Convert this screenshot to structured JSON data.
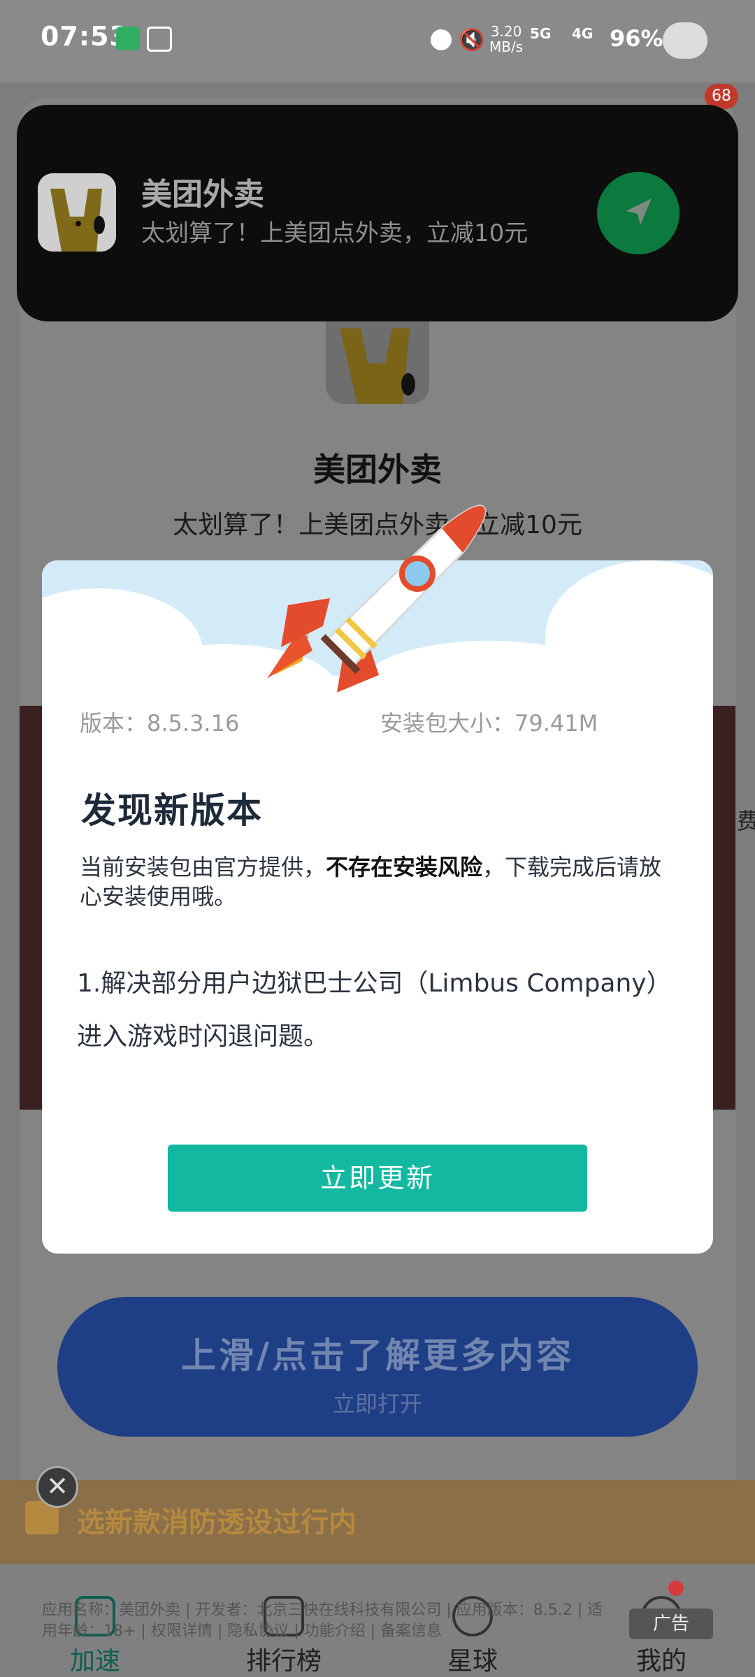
{
  "status_bar": {
    "time": "07:53",
    "net_speed": "3.20",
    "net_unit": "MB/s",
    "sim1": "5G",
    "sim2": "4G",
    "battery": "96%"
  },
  "notification": {
    "app_name": "美团外卖",
    "message": "太划算了！上美团点外卖，立减10元",
    "badge_count": "68"
  },
  "background_page": {
    "title": "美团外卖",
    "subtitle": "太划算了！上美团点外卖，立减10元",
    "side_text": "费",
    "cta_main": "上滑/点击了解更多内容",
    "cta_sub": "立即打开",
    "banner_text": "选新款消防透设过行内",
    "fine_print": "应用名称：美团外卖 | 开发者：北京三快在线科技有限公司 | 应用版本：8.5.2 | 适用年龄：18+ | 权限详情 | 隐私协议 | 功能介绍 | 备案信息",
    "ad_label": "广告",
    "nav": [
      {
        "label": "加速"
      },
      {
        "label": "排行榜"
      },
      {
        "label": "星球"
      },
      {
        "label": "我的"
      }
    ]
  },
  "dialog": {
    "version_label": "版本：8.5.3.16",
    "size_label": "安装包大小：79.41M",
    "heading": "发现新版本",
    "desc_pre": "当前安装包由官方提供，",
    "desc_bold": "不存在安装风险",
    "desc_post": "，下载完成后请放心安装使用哦。",
    "notes": "1.解决部分用户边狱巴士公司（Limbus Company）进入游戏时闪退问题。",
    "update_button": "立即更新"
  },
  "colors": {
    "accent": "#12B8A0",
    "cta_blue": "#1E3F86",
    "notif_bg": "#0D0D0D"
  }
}
